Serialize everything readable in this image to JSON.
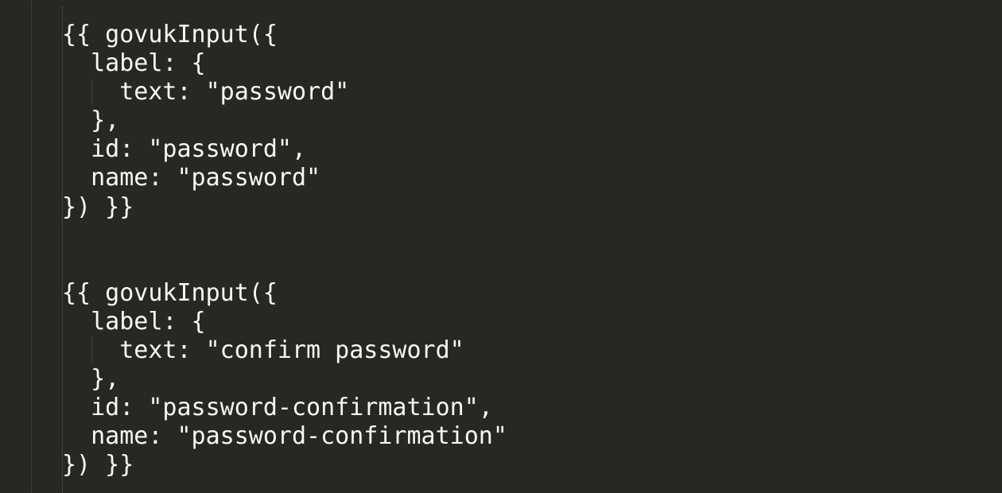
{
  "editor": {
    "lines": [
      "{{ govukInput({",
      "  label: {",
      "    text: \"password\"",
      "  },",
      "  id: \"password\",",
      "  name: \"password\"",
      "}) }}",
      "",
      "",
      "{{ govukInput({",
      "  label: {",
      "    text: \"confirm password\"",
      "  },",
      "  id: \"password-confirmation\",",
      "  name: \"password-confirmation\"",
      "}) }}"
    ]
  }
}
